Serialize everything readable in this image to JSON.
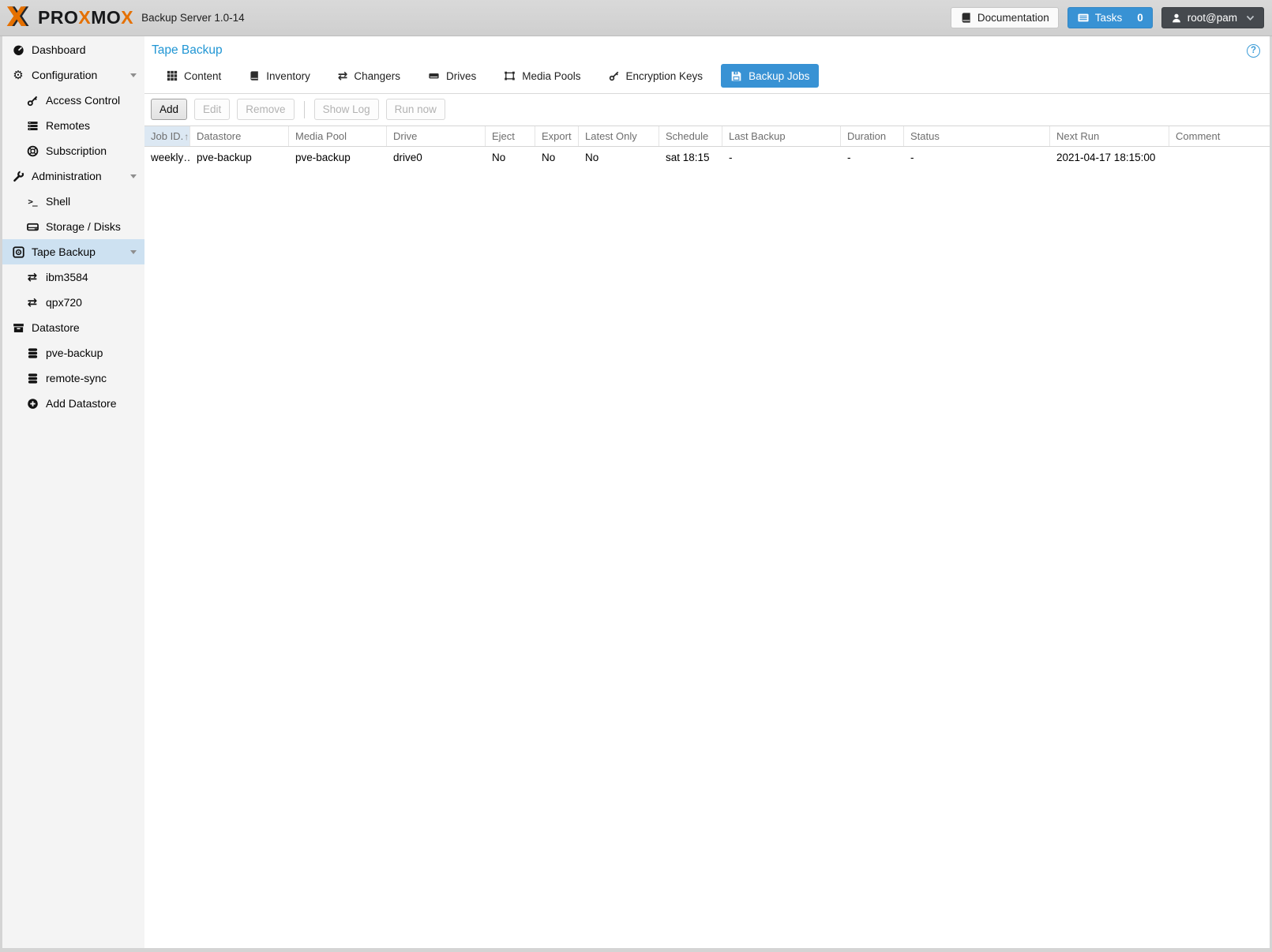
{
  "colors": {
    "accent_blue": "#3892d4",
    "proxmox_orange": "#e57000",
    "sidebar_selection": "#cde1f1",
    "title_blue": "#2196d4",
    "user_button_dark": "#45494e"
  },
  "icons": {
    "gear": "⚙",
    "exchange_arrows": "⇄",
    "shell_prompt": ">_",
    "sort_ascending": "↑",
    "question_mark": "?"
  },
  "header": {
    "logo_mark": "X",
    "logo_parts": [
      "PRO",
      "X",
      "MO",
      "X"
    ],
    "product": "Backup Server 1.0-14",
    "documentation_label": "Documentation",
    "tasks_label": "Tasks",
    "tasks_count": "0",
    "user_label": "root@pam"
  },
  "sidebar": {
    "items": [
      {
        "label": "Dashboard",
        "icon": "dashboard-icon"
      },
      {
        "label": "Configuration",
        "icon": "gears-icon",
        "expanded": true
      },
      {
        "label": "Access Control",
        "icon": "key-icon"
      },
      {
        "label": "Remotes",
        "icon": "remotes-list-icon"
      },
      {
        "label": "Subscription",
        "icon": "life-ring-icon"
      },
      {
        "label": "Administration",
        "icon": "wrench-icon",
        "expanded": true
      },
      {
        "label": "Shell",
        "icon": "terminal-icon"
      },
      {
        "label": "Storage / Disks",
        "icon": "hdd-icon"
      },
      {
        "label": "Tape Backup",
        "icon": "tape-icon",
        "expanded": true,
        "selected": true
      },
      {
        "label": "ibm3584",
        "icon": "exchange-icon"
      },
      {
        "label": "qpx720",
        "icon": "exchange-icon"
      },
      {
        "label": "Datastore",
        "icon": "archive-icon"
      },
      {
        "label": "pve-backup",
        "icon": "database-icon"
      },
      {
        "label": "remote-sync",
        "icon": "database-icon"
      },
      {
        "label": "Add Datastore",
        "icon": "plus-circle-icon"
      }
    ]
  },
  "content": {
    "title": "Tape Backup",
    "tabs": [
      {
        "label": "Content",
        "icon": "grid-icon",
        "active": false
      },
      {
        "label": "Inventory",
        "icon": "book-icon",
        "active": false
      },
      {
        "label": "Changers",
        "icon": "exchange-icon",
        "active": false
      },
      {
        "label": "Drives",
        "icon": "drive-icon",
        "active": false
      },
      {
        "label": "Media Pools",
        "icon": "object-group-icon",
        "active": false
      },
      {
        "label": "Encryption Keys",
        "icon": "key-icon",
        "active": false
      },
      {
        "label": "Backup Jobs",
        "icon": "save-icon",
        "active": true
      }
    ],
    "toolbar": {
      "add_label": "Add",
      "edit_label": "Edit",
      "remove_label": "Remove",
      "show_log_label": "Show Log",
      "run_now_label": "Run now"
    },
    "table": {
      "columns": [
        "Job ID.",
        "Datastore",
        "Media Pool",
        "Drive",
        "Eject",
        "Export",
        "Latest Only",
        "Schedule",
        "Last Backup",
        "Duration",
        "Status",
        "Next Run",
        "Comment"
      ],
      "sorted_column_index": 0,
      "rows": [
        {
          "cells": [
            "weekly…",
            "pve-backup",
            "pve-backup",
            "drive0",
            "No",
            "No",
            "No",
            "sat 18:15",
            "-",
            "-",
            "-",
            "2021-04-17 18:15:00",
            ""
          ]
        }
      ]
    }
  }
}
